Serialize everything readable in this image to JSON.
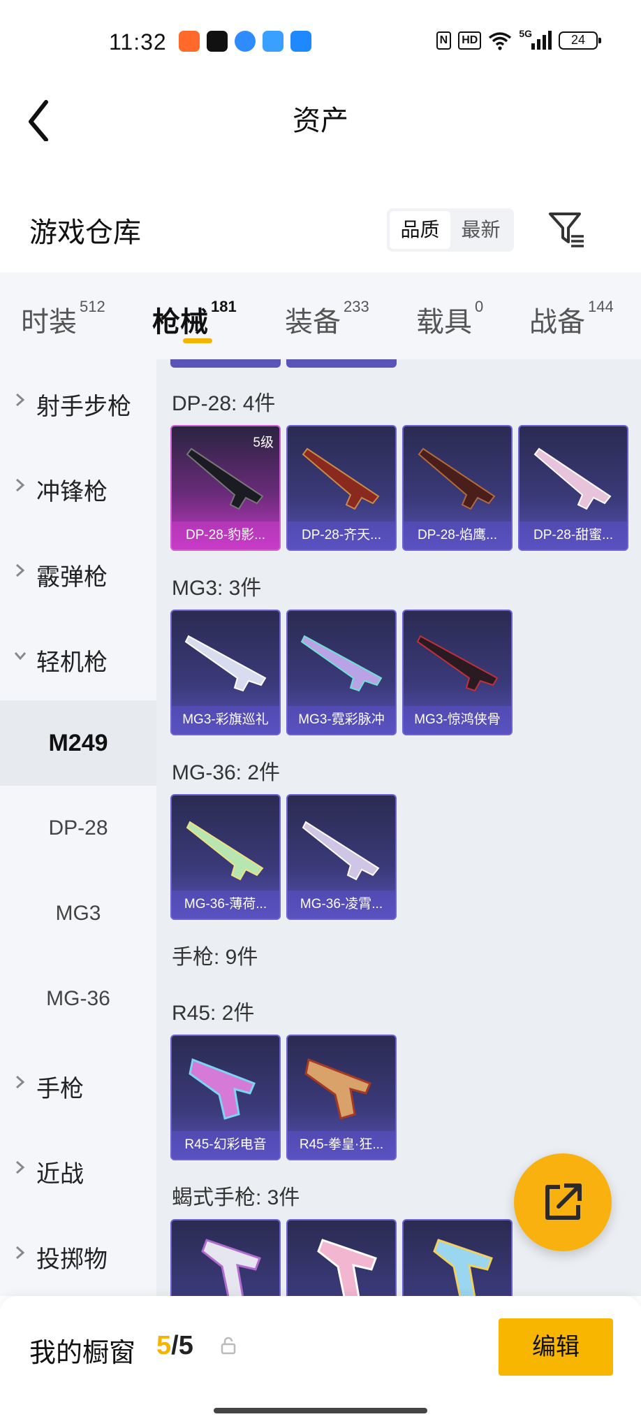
{
  "status_bar": {
    "time": "11:32",
    "network": "5G",
    "battery": "24",
    "hd": "HD",
    "nfc": "N"
  },
  "nav": {
    "title": "资产"
  },
  "warehouse": {
    "title": "游戏仓库",
    "sort_options": [
      "品质",
      "最新"
    ]
  },
  "category_tabs": [
    {
      "label": "时装",
      "count": "512"
    },
    {
      "label": "枪械",
      "count": "181"
    },
    {
      "label": "装备",
      "count": "233"
    },
    {
      "label": "载具",
      "count": "0"
    },
    {
      "label": "战备",
      "count": "144"
    }
  ],
  "sidebar": {
    "groups": [
      "射手步枪",
      "冲锋枪",
      "霰弹枪",
      "轻机枪"
    ],
    "subitems": [
      "M249",
      "DP-28",
      "MG3",
      "MG-36"
    ],
    "more_groups": [
      "手枪",
      "近战",
      "投掷物"
    ]
  },
  "sections": {
    "dp28": {
      "title": "DP-28: 4件",
      "items": [
        {
          "name": "DP-28-豹影...",
          "level": "5级"
        },
        {
          "name": "DP-28-齐天..."
        },
        {
          "name": "DP-28-焰鹰..."
        },
        {
          "name": "DP-28-甜蜜..."
        }
      ]
    },
    "mg3": {
      "title": "MG3: 3件",
      "items": [
        {
          "name": "MG3-彩旗巡礼"
        },
        {
          "name": "MG3-霓彩脉冲"
        },
        {
          "name": "MG3-惊鸿侠骨"
        }
      ]
    },
    "mg36": {
      "title": "MG-36: 2件",
      "items": [
        {
          "name": "MG-36-薄荷..."
        },
        {
          "name": "MG-36-凌霄..."
        }
      ]
    },
    "pistol": {
      "title": "手枪: 9件"
    },
    "r45": {
      "title": "R45: 2件",
      "items": [
        {
          "name": "R45-幻彩电音"
        },
        {
          "name": "R45-拳皇·狂..."
        }
      ]
    },
    "scorpion": {
      "title": "蝎式手枪: 3件"
    }
  },
  "bottom": {
    "showcase_label": "我的橱窗",
    "showcase_current": "5",
    "showcase_sep_total": "/5",
    "edit_label": "编辑"
  },
  "colors": {
    "accent": "#f5b400",
    "card_purple": "#5a53b8",
    "card_pink": "#c73ac7"
  }
}
